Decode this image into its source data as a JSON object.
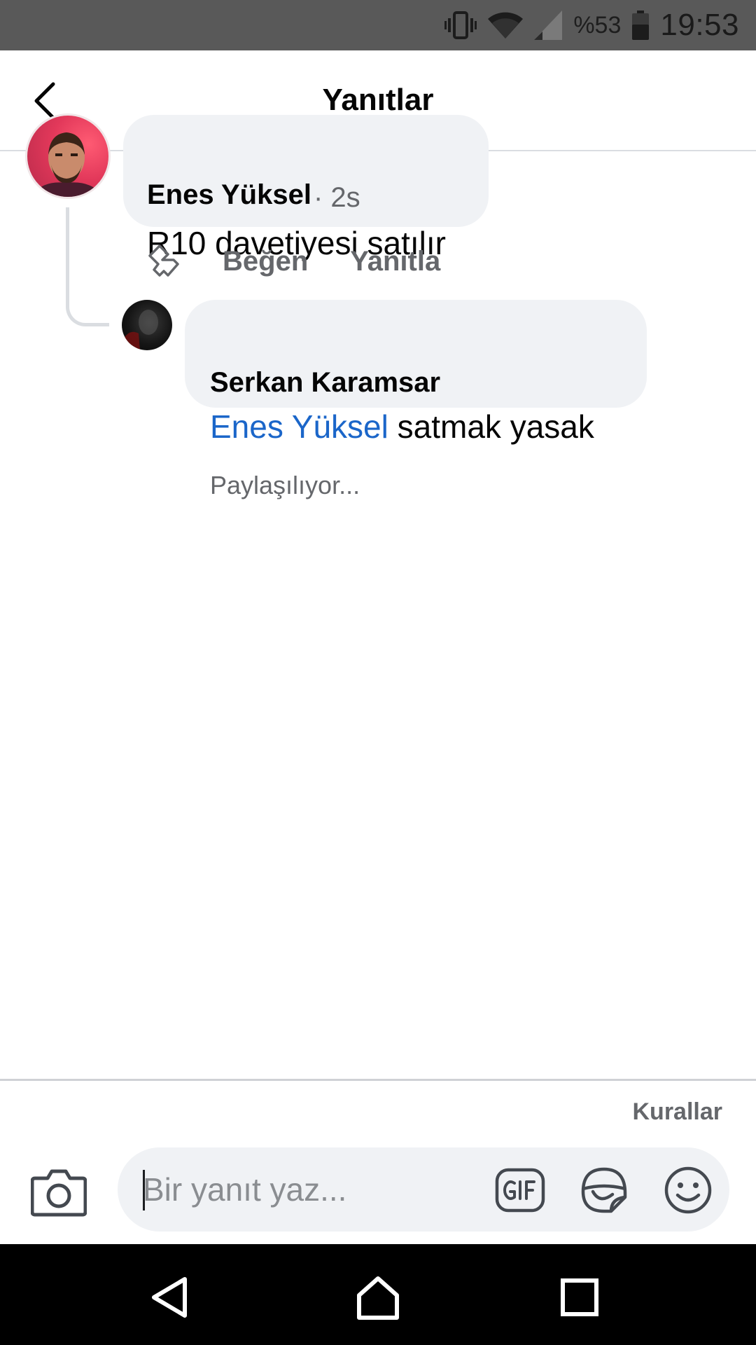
{
  "status_bar": {
    "battery_percent": "%53",
    "time": "19:53",
    "icons": [
      "vibrate-icon",
      "wifi-icon",
      "signal-icon",
      "battery-icon"
    ]
  },
  "header": {
    "title": "Yanıtlar",
    "back_icon": "chevron-left-icon"
  },
  "comment": {
    "author": "Enes Yüksel",
    "time": "· 2s",
    "text": "R10 davetiyesi satılır",
    "actions": {
      "react_icon": "reaction-icon",
      "like": "Beğen",
      "reply": "Yanıtla"
    }
  },
  "reply": {
    "author": "Serkan Karamsar",
    "mention": "Enes Yüksel",
    "text": " satmak yasak",
    "status": "Paylaşılıyor..."
  },
  "composer": {
    "rules_link": "Kurallar",
    "placeholder": "Bir yanıt yaz...",
    "value": "",
    "icons": [
      "camera-icon",
      "gif-icon",
      "sticker-icon",
      "emoji-icon"
    ]
  },
  "nav_bar": {
    "icons": [
      "nav-back-icon",
      "nav-home-icon",
      "nav-recents-icon"
    ]
  },
  "colors": {
    "status_bar": "#595959",
    "bubble": "#f0f2f5",
    "mention": "#1b66c9",
    "secondary_text": "#65676b",
    "nav_bar": "#000000"
  }
}
